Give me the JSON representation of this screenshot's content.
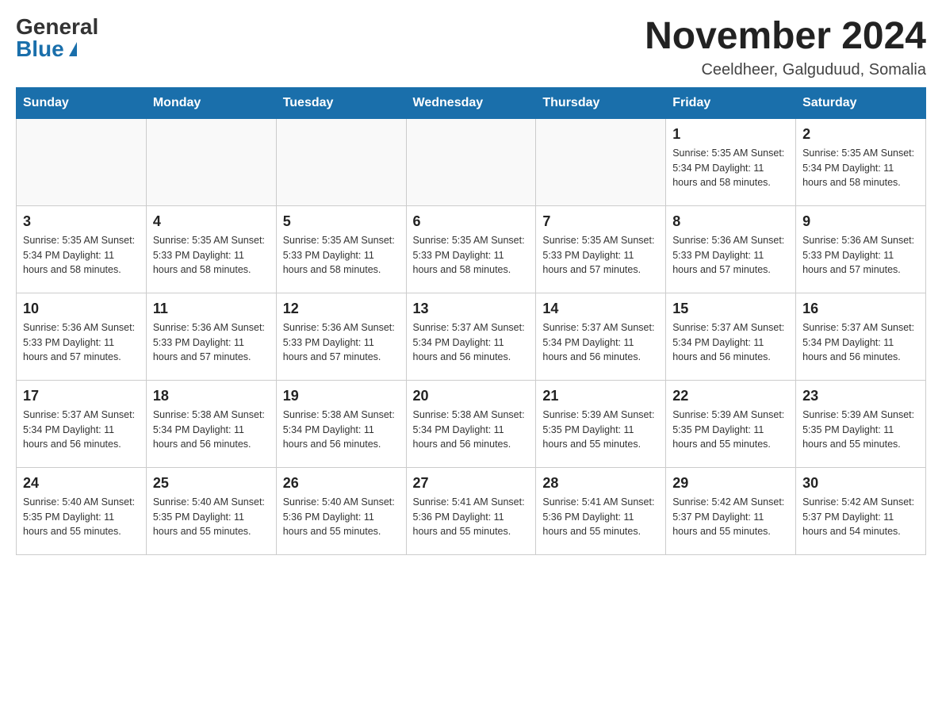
{
  "header": {
    "logo_general": "General",
    "logo_blue": "Blue",
    "month_title": "November 2024",
    "location": "Ceeldheer, Galguduud, Somalia"
  },
  "weekdays": [
    "Sunday",
    "Monday",
    "Tuesday",
    "Wednesday",
    "Thursday",
    "Friday",
    "Saturday"
  ],
  "weeks": [
    [
      {
        "day": "",
        "info": ""
      },
      {
        "day": "",
        "info": ""
      },
      {
        "day": "",
        "info": ""
      },
      {
        "day": "",
        "info": ""
      },
      {
        "day": "",
        "info": ""
      },
      {
        "day": "1",
        "info": "Sunrise: 5:35 AM\nSunset: 5:34 PM\nDaylight: 11 hours\nand 58 minutes."
      },
      {
        "day": "2",
        "info": "Sunrise: 5:35 AM\nSunset: 5:34 PM\nDaylight: 11 hours\nand 58 minutes."
      }
    ],
    [
      {
        "day": "3",
        "info": "Sunrise: 5:35 AM\nSunset: 5:34 PM\nDaylight: 11 hours\nand 58 minutes."
      },
      {
        "day": "4",
        "info": "Sunrise: 5:35 AM\nSunset: 5:33 PM\nDaylight: 11 hours\nand 58 minutes."
      },
      {
        "day": "5",
        "info": "Sunrise: 5:35 AM\nSunset: 5:33 PM\nDaylight: 11 hours\nand 58 minutes."
      },
      {
        "day": "6",
        "info": "Sunrise: 5:35 AM\nSunset: 5:33 PM\nDaylight: 11 hours\nand 58 minutes."
      },
      {
        "day": "7",
        "info": "Sunrise: 5:35 AM\nSunset: 5:33 PM\nDaylight: 11 hours\nand 57 minutes."
      },
      {
        "day": "8",
        "info": "Sunrise: 5:36 AM\nSunset: 5:33 PM\nDaylight: 11 hours\nand 57 minutes."
      },
      {
        "day": "9",
        "info": "Sunrise: 5:36 AM\nSunset: 5:33 PM\nDaylight: 11 hours\nand 57 minutes."
      }
    ],
    [
      {
        "day": "10",
        "info": "Sunrise: 5:36 AM\nSunset: 5:33 PM\nDaylight: 11 hours\nand 57 minutes."
      },
      {
        "day": "11",
        "info": "Sunrise: 5:36 AM\nSunset: 5:33 PM\nDaylight: 11 hours\nand 57 minutes."
      },
      {
        "day": "12",
        "info": "Sunrise: 5:36 AM\nSunset: 5:33 PM\nDaylight: 11 hours\nand 57 minutes."
      },
      {
        "day": "13",
        "info": "Sunrise: 5:37 AM\nSunset: 5:34 PM\nDaylight: 11 hours\nand 56 minutes."
      },
      {
        "day": "14",
        "info": "Sunrise: 5:37 AM\nSunset: 5:34 PM\nDaylight: 11 hours\nand 56 minutes."
      },
      {
        "day": "15",
        "info": "Sunrise: 5:37 AM\nSunset: 5:34 PM\nDaylight: 11 hours\nand 56 minutes."
      },
      {
        "day": "16",
        "info": "Sunrise: 5:37 AM\nSunset: 5:34 PM\nDaylight: 11 hours\nand 56 minutes."
      }
    ],
    [
      {
        "day": "17",
        "info": "Sunrise: 5:37 AM\nSunset: 5:34 PM\nDaylight: 11 hours\nand 56 minutes."
      },
      {
        "day": "18",
        "info": "Sunrise: 5:38 AM\nSunset: 5:34 PM\nDaylight: 11 hours\nand 56 minutes."
      },
      {
        "day": "19",
        "info": "Sunrise: 5:38 AM\nSunset: 5:34 PM\nDaylight: 11 hours\nand 56 minutes."
      },
      {
        "day": "20",
        "info": "Sunrise: 5:38 AM\nSunset: 5:34 PM\nDaylight: 11 hours\nand 56 minutes."
      },
      {
        "day": "21",
        "info": "Sunrise: 5:39 AM\nSunset: 5:35 PM\nDaylight: 11 hours\nand 55 minutes."
      },
      {
        "day": "22",
        "info": "Sunrise: 5:39 AM\nSunset: 5:35 PM\nDaylight: 11 hours\nand 55 minutes."
      },
      {
        "day": "23",
        "info": "Sunrise: 5:39 AM\nSunset: 5:35 PM\nDaylight: 11 hours\nand 55 minutes."
      }
    ],
    [
      {
        "day": "24",
        "info": "Sunrise: 5:40 AM\nSunset: 5:35 PM\nDaylight: 11 hours\nand 55 minutes."
      },
      {
        "day": "25",
        "info": "Sunrise: 5:40 AM\nSunset: 5:35 PM\nDaylight: 11 hours\nand 55 minutes."
      },
      {
        "day": "26",
        "info": "Sunrise: 5:40 AM\nSunset: 5:36 PM\nDaylight: 11 hours\nand 55 minutes."
      },
      {
        "day": "27",
        "info": "Sunrise: 5:41 AM\nSunset: 5:36 PM\nDaylight: 11 hours\nand 55 minutes."
      },
      {
        "day": "28",
        "info": "Sunrise: 5:41 AM\nSunset: 5:36 PM\nDaylight: 11 hours\nand 55 minutes."
      },
      {
        "day": "29",
        "info": "Sunrise: 5:42 AM\nSunset: 5:37 PM\nDaylight: 11 hours\nand 55 minutes."
      },
      {
        "day": "30",
        "info": "Sunrise: 5:42 AM\nSunset: 5:37 PM\nDaylight: 11 hours\nand 54 minutes."
      }
    ]
  ]
}
